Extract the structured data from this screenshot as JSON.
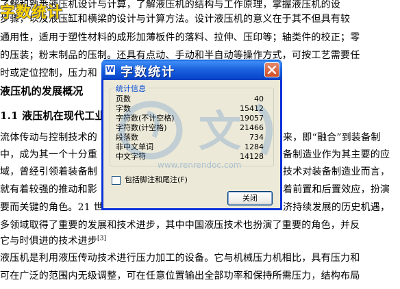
{
  "watermark": "字数统计",
  "document": {
    "lines": [
      "了解和熟悉液压机设计与计算，了解液压机的结构与工作原理，掌握液压机的设",
      "步骤，以及液压缸和横梁的设计与计算方法。设计液压机的意义在于其不但具有较",
      "通用性，适用于塑性材料的成形加薄板件的落料、拉伸、压印等；轴类件的校正；零",
      "的压装；粉末制品的压制。还具有点动、手动和半自动等操作方式，可按工艺需要任",
      "时或定位控制，压力和",
      "液压机的发展概况",
      "1.1  液压机在现代工业",
      "流体传动与控制技术的",
      "中，成为其一个十分重",
      "域，曾经引领着装备制",
      "就有着较强的推动和影",
      "要而关键的角色。21 世",
      "多领域取得了重要的发展和技术进步，其中中国液压技术也扮演了重要的角色，并反",
      "它与时俱进的技术进步",
      "液压机是利用液压传动技术进行压力加工的设备。它与机械压力机相比，具有压力和",
      "可在广泛的范围内无级调整，可在任意位置输出全部功率和保持所需压力，结构布局"
    ],
    "right_fragments": [
      "来，即“融合”到装备制",
      "备制造业作为其主要的应",
      "技术对装备制造业而言，",
      "着前置和后置效应，扮演",
      "济持续发展的历史机遇，"
    ],
    "citation": "[3]"
  },
  "dialog": {
    "title": "字数统计",
    "app_icon": "W",
    "group_title": "统计信息",
    "stats": [
      {
        "label": "页数",
        "value": "40"
      },
      {
        "label": "字数",
        "value": "15412"
      },
      {
        "label": "字符数(不计空格)",
        "value": "19057"
      },
      {
        "label": "字符数(计空格)",
        "value": "21466"
      },
      {
        "label": "段落数",
        "value": "734"
      },
      {
        "label": "非中文单词",
        "value": "1284"
      },
      {
        "label": "中文字符",
        "value": "14128"
      }
    ],
    "include_footnotes_label": "包括脚注和尾注(F)",
    "close_button": "关闭"
  },
  "site_watermark": {
    "text": "文",
    "url": "www.renrendoc.com"
  },
  "colors": {
    "titlebar": "#0b4ad0",
    "dialog_bg": "#ece9d8",
    "group_title": "#0046d5",
    "close_red": "#d24d25",
    "watermark_yellow": "#ffd400"
  }
}
